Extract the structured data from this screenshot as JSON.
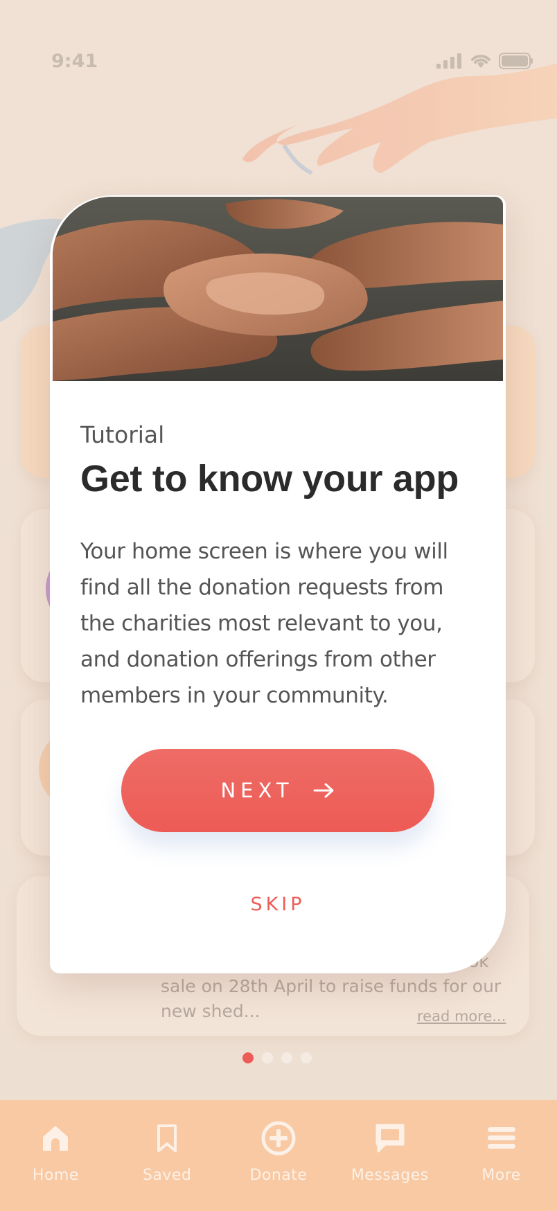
{
  "status_bar": {
    "time": "9:41"
  },
  "background": {
    "post_snippet_partial": "ok",
    "post_snippet_line2": "sale on 28th April to raise funds for our",
    "post_snippet_line3": "new shed...",
    "read_more": "read more..."
  },
  "tutorial": {
    "eyebrow": "Tutorial",
    "title": "Get to know your app",
    "body": "Your home screen is where you will find all the donation requests from the charities most relevant to you, and donation offerings from other members in your community.",
    "next_label": "NEXT",
    "skip_label": "SKIP"
  },
  "pagination": {
    "total": 4,
    "active": 1
  },
  "bottom_nav": {
    "items": [
      {
        "label": "Home",
        "icon": "home-icon"
      },
      {
        "label": "Saved",
        "icon": "bookmark-icon"
      },
      {
        "label": "Donate",
        "icon": "plus-circle-icon"
      },
      {
        "label": "Messages",
        "icon": "chat-icon"
      },
      {
        "label": "More",
        "icon": "menu-icon"
      }
    ]
  },
  "colors": {
    "accent": "#ec5d57",
    "nav_background": "#f8c9a3",
    "screen_background": "#efe0d3"
  }
}
